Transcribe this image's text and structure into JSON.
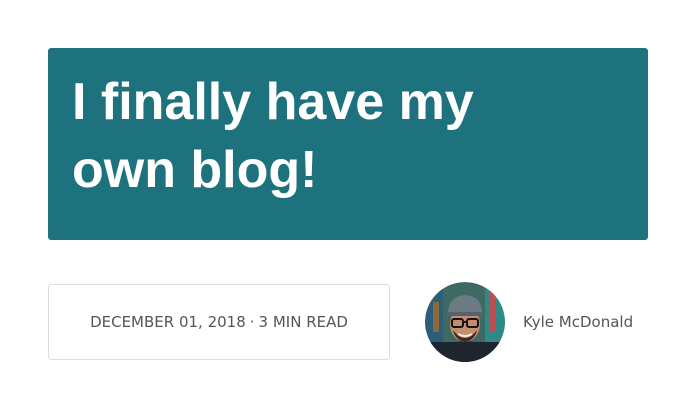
{
  "post": {
    "title": "I finally have my own blog!",
    "date": "DECEMBER 01, 2018",
    "separator": "·",
    "read_time": "3 MIN READ"
  },
  "author": {
    "name": "Kyle McDonald",
    "avatar_icon": "avatar-photo"
  },
  "colors": {
    "title_background": "#1e727e",
    "title_text": "#ffffff",
    "meta_text": "#555555",
    "meta_border": "#dddddd"
  }
}
